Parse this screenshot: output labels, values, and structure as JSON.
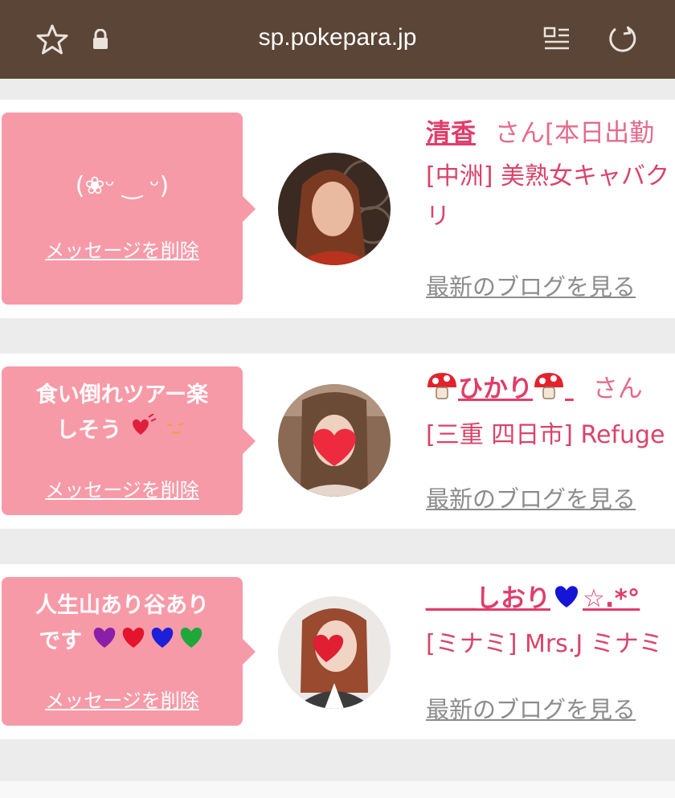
{
  "browser": {
    "url": "sp.pokepara.jp",
    "icons": [
      "star-icon",
      "lock-icon",
      "reader-icon",
      "reload-icon"
    ]
  },
  "colors": {
    "topbar": "#5b4536",
    "bubble": "#f79aa8",
    "name": "#e03d6a",
    "blog_link": "#8c8c8c"
  },
  "cards": [
    {
      "message": "(❀ᵕ ‿ ᵕ)",
      "delete_label": "メッセージを削除",
      "name": "清香",
      "honorific": "さん[本日出勤",
      "shop_line1": "[中洲] 美熟女キャバク",
      "shop_line2": "リ",
      "blog_label": "最新のブログを見る"
    },
    {
      "message_line1": "食い倒れツアー楽",
      "message_line2": "しそう",
      "delete_label": "メッセージを削除",
      "name": "ひかり",
      "honorific": "さん",
      "shop_line1": "[三重 四日市] Refuge",
      "blog_label": "最新のブログを見る"
    },
    {
      "message_line1": "人生山あり谷あり",
      "message_line2": "です",
      "delete_label": "メッセージを削除",
      "name_prefix": "＿＿",
      "name": "しおり",
      "name_suffix": "☆.*°",
      "shop_line1": "[ミナミ] Mrs.J ミナミ",
      "blog_label": "最新のブログを見る"
    }
  ]
}
